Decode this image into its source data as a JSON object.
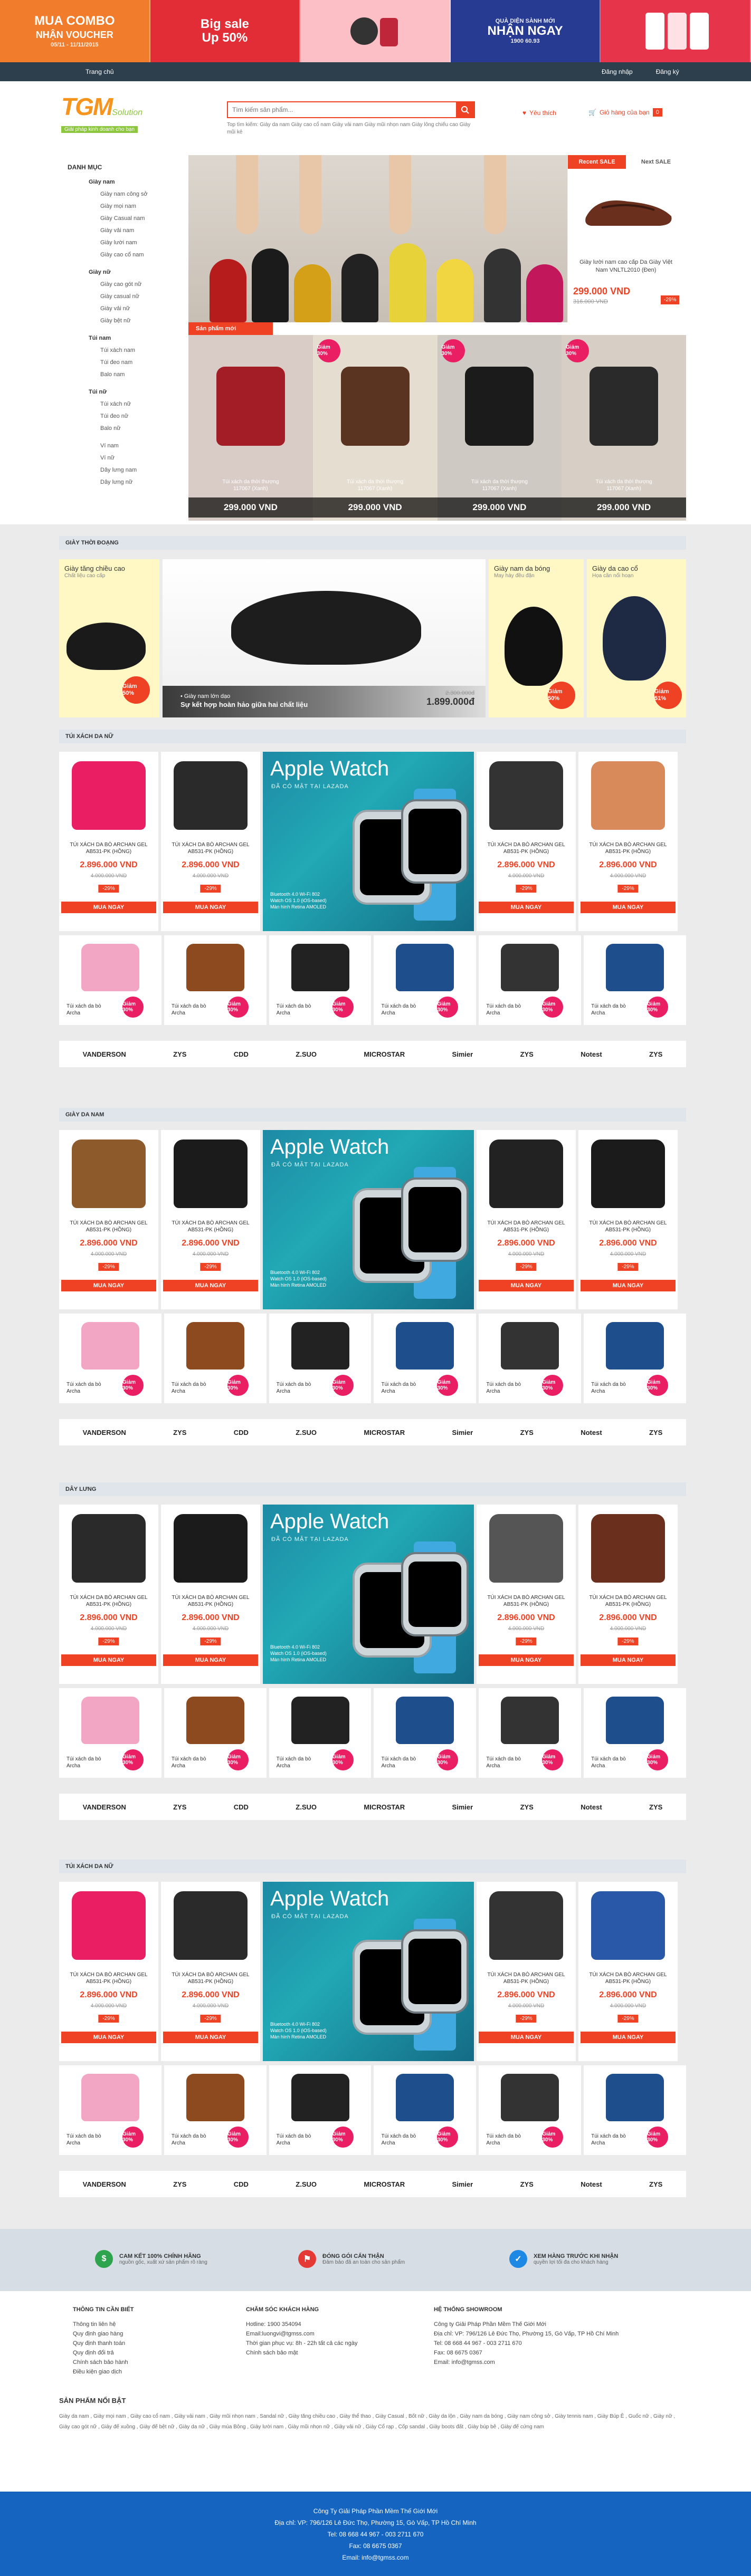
{
  "promo": {
    "banners": [
      {
        "title": "MUA COMBO",
        "sub": "NHẬN VOUCHER",
        "note": "05/11 - 11/11/2015"
      },
      {
        "title": "Big sale",
        "sub": "Up 50%",
        "note": ""
      },
      {
        "title": "",
        "sub": "",
        "note": ""
      },
      {
        "title": "QUÀ DIỆN SÀNH MỚI",
        "sub": "NHẬN NGAY",
        "note": "1900 60.93"
      },
      {
        "title": "",
        "sub": "",
        "note": ""
      }
    ]
  },
  "topbar": {
    "home": "Trang chủ",
    "register": "Đăng nhập",
    "login": "Đăng ký"
  },
  "header": {
    "logo": "TGM",
    "logo_suffix": "Solution",
    "tagline": "Giải pháp kinh doanh cho bạn",
    "search_placeholder": "Tìm kiếm sản phẩm...",
    "hot_keywords": "Top tìm kiếm: Giày da nam Giày cao cổ nam Giày vải nam Giày mũi nhọn nam Giày lông chiếu cao Giày mũi kẻ",
    "wishlist": "Yêu thích",
    "cart": "Giỏ hàng của bạn",
    "cart_count": "0"
  },
  "category_menu": {
    "title": "DANH MỤC",
    "groups": [
      {
        "name": "Giày nam",
        "items": [
          "Giày nam công sở",
          "Giày mọi nam",
          "Giày Casual nam",
          "Giày vải nam",
          "Giày lười nam",
          "Giày cao cổ nam"
        ]
      },
      {
        "name": "Giày nữ",
        "items": [
          "Giày cao gót nữ",
          "Giày casual nữ",
          "Giày vải nữ",
          "Giày bệt nữ"
        ]
      },
      {
        "name": "Túi nam",
        "items": [
          "Túi xách nam",
          "Túi đeo nam",
          "Balo nam"
        ]
      },
      {
        "name": "Túi nữ",
        "items": [
          "Túi xách nữ",
          "Túi đeo nữ",
          "Balo nữ"
        ]
      },
      {
        "name": "",
        "items": [
          "Ví nam",
          "Ví nữ",
          "Dây lưng nam",
          "Dây lưng nữ"
        ]
      }
    ]
  },
  "side_deal": {
    "tab_recent": "Recent SALE",
    "tab_next": "Next SALE",
    "name": "Giày lười nam cao cấp Da Giày Việt Nam VNLTL2010 (Đen)",
    "price": "299.000 VND",
    "old_price": "316.000 VND",
    "pct": "-29%"
  },
  "new_products": {
    "label": "Sản phẩm mới",
    "items": [
      {
        "name": "Túi xách da thời thượng\n117067 (Xanh)",
        "price": "299.000 VND",
        "badge": ""
      },
      {
        "name": "Túi xách da thời thượng\n117067 (Xanh)",
        "price": "299.000 VND",
        "badge": "Giảm 30%"
      },
      {
        "name": "Túi xách da thời thượng\n117067 (Xanh)",
        "price": "299.000 VND",
        "badge": "Giảm 30%"
      },
      {
        "name": "Túi xách da thời thượng\n117067 (Xanh)",
        "price": "299.000 VND",
        "badge": "Giảm 30%"
      }
    ]
  },
  "shoe_promo": {
    "header": "GIÀY THỜI ĐOẠNG",
    "left_title": "Giày tăng chiều cao",
    "left_sub": "Chất liệu cao cấp",
    "left_badge": "Giảm 50%",
    "feature_line1": "• Giày nam lớn dạo",
    "feature_line2": "Sự kết hợp hoàn hảo giữa hai chất liệu",
    "feature_old": "2.300.000đ",
    "feature_price": "1.899.000đ",
    "mid_title": "Giày nam da bóng",
    "mid_sub": "May hày đều đặn",
    "mid_badge": "Giảm 50%",
    "right_title": "Giày da cao cổ",
    "right_sub": "Họa cần nổi hoạn",
    "right_badge": "Giảm 51%"
  },
  "sections": [
    {
      "title": "TÚI XÁCH DA NỮ"
    },
    {
      "title": "GIÀY DA NAM"
    },
    {
      "title": "DÂY LƯNG"
    },
    {
      "title": "TÚI XÁCH DA NỮ"
    }
  ],
  "product": {
    "name": "TÚI XÁCH DA BÒ ARCHAN GEL AB531-PK (HỒNG)",
    "price": "2.896.000 VND",
    "old_price": "4.000.000 VND",
    "pct": "-29%",
    "buy": "MUA NGAY"
  },
  "small_product": {
    "name": "Túi xách da bò Archa",
    "badge": "Giảm 30%"
  },
  "watch_ad": {
    "title": "Apple Watch",
    "sub": "ĐÃ CÓ MẶT TẠI LAZADA",
    "spec": "Bluetooth 4.0 Wi-Fi 802\nWatch OS 1.0 (iOS-based)\nMàn hình Retina AMOLED"
  },
  "brands": [
    "VANDERSON",
    "ZYS",
    "CDD",
    "Z.SUO",
    "MICROSTAR",
    "Simier",
    "ZYS",
    "Notest",
    "ZYS"
  ],
  "services": [
    {
      "title": "CAM KẾT 100% CHÍNH HÃNG",
      "desc": "nguồn gốc, xuất xứ sản phẩm rõ ràng",
      "icon": "$",
      "color": "#2ea44f"
    },
    {
      "title": "ĐÓNG GÓI CẨN THẬN",
      "desc": "Đảm bảo đã an toàn cho sản phẩm",
      "icon": "⚑",
      "color": "#e53935"
    },
    {
      "title": "XEM HÀNG TRƯỚC KHI NHẬN",
      "desc": "quyền lợi tối đa cho khách hàng",
      "icon": "✓",
      "color": "#1e88e5"
    }
  ],
  "footer_cols": [
    {
      "title": "THÔNG TIN CẦN BIẾT",
      "items": [
        "Thông tin liên hệ",
        "Quy định giao hàng",
        "Quy định thanh toán",
        "Quy định đổi trả",
        "Chính sách bảo hành",
        "Điều kiện giao dịch"
      ]
    },
    {
      "title": "CHĂM SÓC KHÁCH HÀNG",
      "items": [
        "Hotline: 1900 354094",
        "Email:luongvi@tgmss.com",
        "Thời gian phục vụ: 8h - 22h tất cả các ngày",
        "Chính sách bảo mật"
      ]
    },
    {
      "title": "HỆ THỐNG SHOWROOM",
      "items": [
        "Công ty Giải Pháp Phần Mềm Thế Giới Mới",
        "Địa chỉ: VP: 796/126 Lê Đức Thọ, Phường 15, Gò Vấp, TP Hồ Chí Minh",
        "Tel: 08 668 44 967 - 003 2711 670",
        "Fax: 08 6675 0367",
        "Email: info@tgmss.com"
      ]
    }
  ],
  "featured": {
    "title": "SẢN PHẨM NỔI BẬT",
    "keywords": "Giày da nam , Giày mọi nam , Giày cao cổ nam , Giày vải nam , Giày mũi nhọn nam , Sandal nữ , Giày tăng chiều cao , Giày thể thao , Giày Casual , Bốt nữ , Giày da lộn , Giày nam da bóng , Giày nam công sở , Giày tennis nam , Giày Búp Ê , Guốc nữ , Giày nữ , Giày cao gót nữ , Giày đế xuồng , Giày đế bệt nữ , Giày da nữ , Giày múa Bông , Giày lười nam , Giày mũi nhọn nữ , Giày vải nữ , Giày Cổ rạp , Cốp sandal , Giày boots đất , Giày búp bê , Giày đế cứng nam"
  },
  "footer": {
    "company": "Công Ty Giải Pháp Phần Mềm Thế Giới Mới",
    "address": "Địa chỉ: VP: 796/126 Lê Đức Thọ, Phường 15, Gò Vấp, TP Hồ Chí Minh",
    "tel": "Tel: 08 668 44 967 - 003 2711 670",
    "fax": "Fax: 08 6675 0367",
    "email": "Email: info@tgmss.com"
  }
}
